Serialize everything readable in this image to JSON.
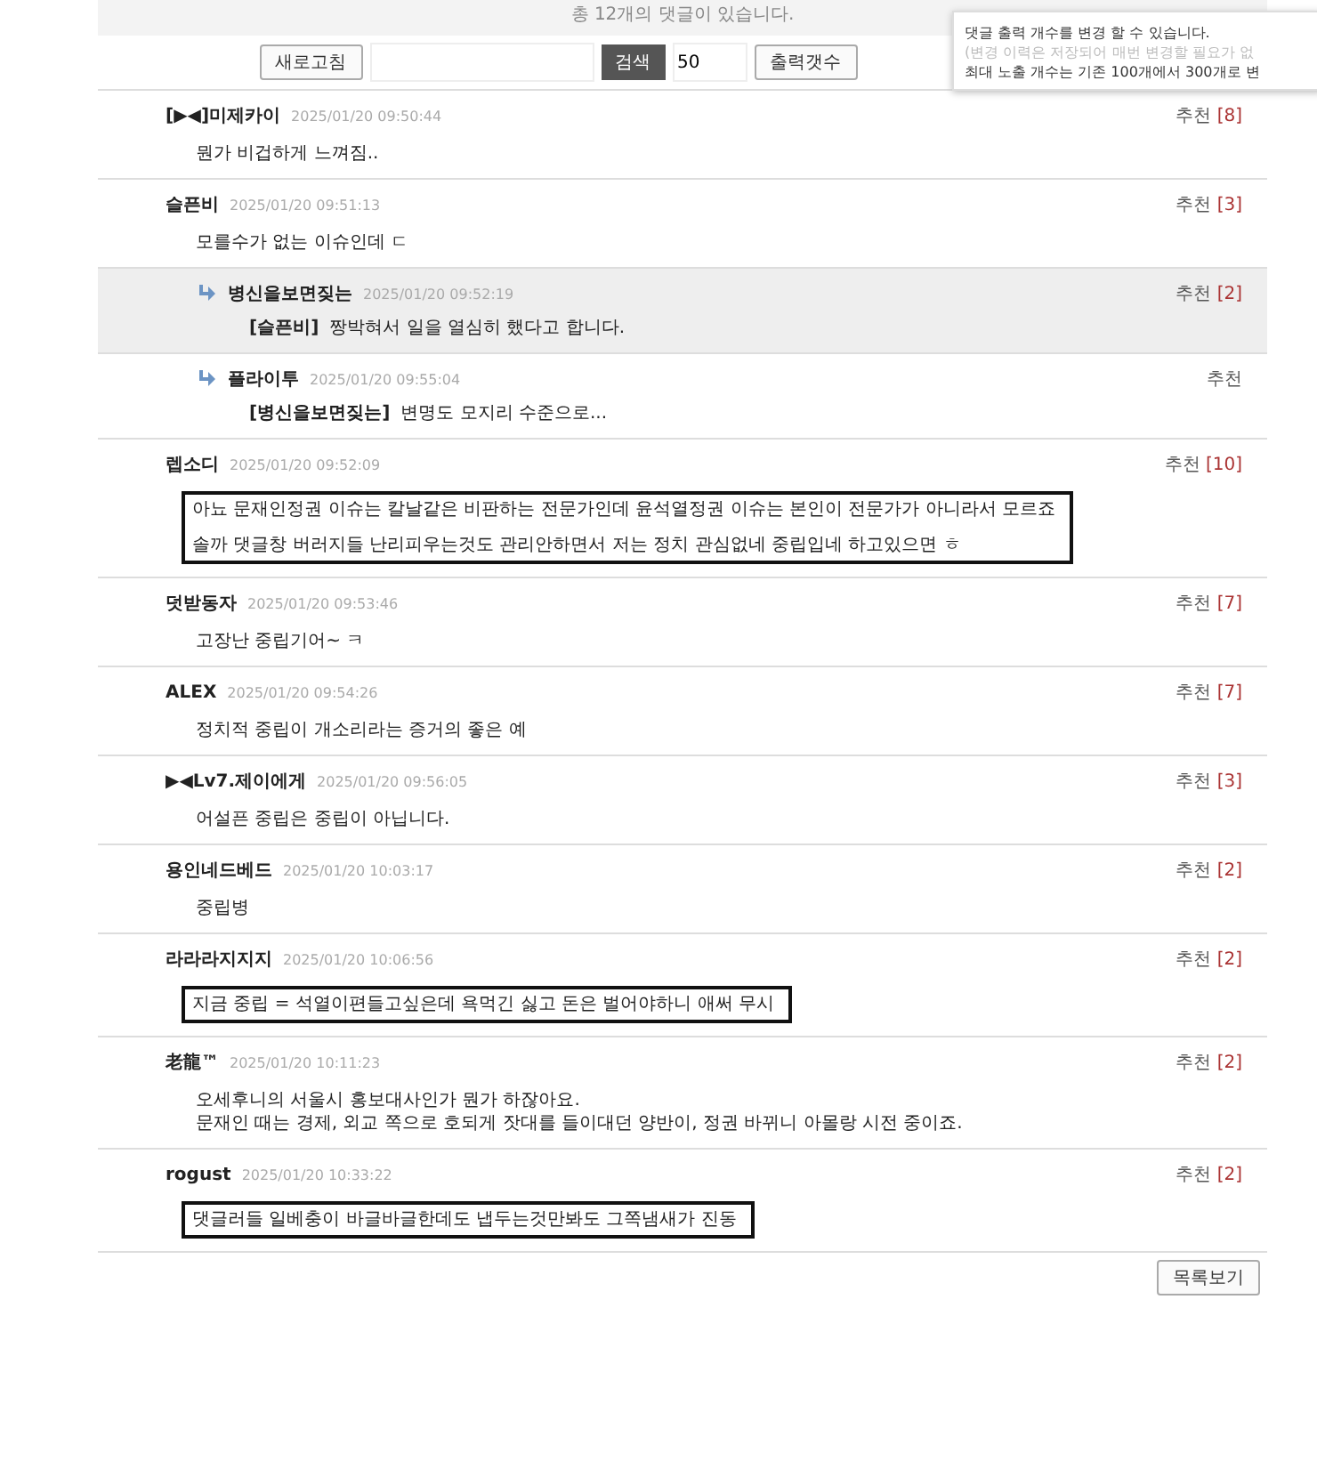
{
  "summary": "총 12개의 댓글이 있습니다.",
  "toolbar": {
    "refresh_button": "새로고침",
    "search_button": "검색",
    "count_value": "50",
    "count_button": "출력갯수"
  },
  "tooltip": {
    "lines": [
      "댓글 출력 개수를 변경 할 수 있습니다.",
      "(변경 이력은 저장되어 매번 변경할 필요가 없",
      "최대 노출 개수는 기존 100개에서 300개로 변"
    ]
  },
  "comments": [
    {
      "kind": "comment",
      "author": "[▶◀]미제카이",
      "time": "2025/01/20 09:50:44",
      "recommend": "추천",
      "count": "[8]",
      "highlighted": false,
      "boxed": false,
      "lines": [
        "뭔가 비겁하게 느껴짐.."
      ]
    },
    {
      "kind": "comment",
      "author": "슬픈비",
      "time": "2025/01/20 09:51:13",
      "recommend": "추천",
      "count": "[3]",
      "highlighted": false,
      "boxed": false,
      "lines": [
        "모를수가 없는 이슈인데 ㄷ"
      ]
    },
    {
      "kind": "reply",
      "author": "병신을보면짖는",
      "time": "2025/01/20 09:52:19",
      "recommend": "추천",
      "count": "[2]",
      "highlighted": true,
      "boxed": false,
      "target": "[슬픈비]",
      "lines": [
        "짱박혀서 일을 열심히 했다고 합니다."
      ]
    },
    {
      "kind": "reply",
      "author": "플라이투",
      "time": "2025/01/20 09:55:04",
      "recommend": "추천",
      "highlighted": false,
      "boxed": false,
      "target": "[병신을보면짖는]",
      "lines": [
        "변명도 모지리 수준으로..."
      ]
    },
    {
      "kind": "comment",
      "author": "렙소디",
      "time": "2025/01/20 09:52:09",
      "recommend": "추천",
      "count": "[10]",
      "highlighted": false,
      "boxed": true,
      "lines": [
        "아뇨 문재인정권 이슈는 칼날같은 비판하는 전문가인데 윤석열정권 이슈는 본인이 전문가가 아니라서 모르죠",
        "솔까 댓글창 버러지들 난리피우는것도 관리안하면서 저는 정치 관심없네 중립입네 하고있으면 ㅎ"
      ]
    },
    {
      "kind": "comment",
      "author": "덧받동자",
      "time": "2025/01/20 09:53:46",
      "recommend": "추천",
      "count": "[7]",
      "highlighted": false,
      "boxed": false,
      "lines": [
        "고장난 중립기어~ ㅋ"
      ]
    },
    {
      "kind": "comment",
      "author": "ALEX",
      "time": "2025/01/20 09:54:26",
      "recommend": "추천",
      "count": "[7]",
      "highlighted": false,
      "boxed": false,
      "lines": [
        "정치적 중립이 개소리라는 증거의 좋은 예"
      ]
    },
    {
      "kind": "comment",
      "author": "▶◀Lv7.제이에게",
      "time": "2025/01/20 09:56:05",
      "recommend": "추천",
      "count": "[3]",
      "highlighted": false,
      "boxed": false,
      "lines": [
        "어설픈 중립은 중립이 아닙니다."
      ]
    },
    {
      "kind": "comment",
      "author": "용인네드베드",
      "time": "2025/01/20 10:03:17",
      "recommend": "추천",
      "count": "[2]",
      "highlighted": false,
      "boxed": false,
      "lines": [
        "중립병"
      ]
    },
    {
      "kind": "comment",
      "author": "라라라지지지",
      "time": "2025/01/20 10:06:56",
      "recommend": "추천",
      "count": "[2]",
      "highlighted": false,
      "boxed": true,
      "lines": [
        "지금 중립 = 석열이편들고싶은데 욕먹긴 싫고 돈은 벌어야하니 애써 무시"
      ]
    },
    {
      "kind": "comment",
      "author": "老龍™",
      "time": "2025/01/20 10:11:23",
      "recommend": "추천",
      "count": "[2]",
      "highlighted": false,
      "boxed": false,
      "lines": [
        "오세후니의 서울시 홍보대사인가 뭔가 하잖아요.",
        "문재인 때는 경제, 외교 쪽으로 호되게 잣대를 들이대던 양반이, 정권 바뀌니 아몰랑 시전 중이죠."
      ]
    },
    {
      "kind": "comment",
      "author": "rogust",
      "time": "2025/01/20 10:33:22",
      "recommend": "추천",
      "count": "[2]",
      "highlighted": false,
      "boxed": true,
      "lines": [
        "댓글러들 일베충이 바글바글한데도 냅두는것만봐도 그쪽냄새가 진동"
      ]
    }
  ],
  "list_button": "목록보기"
}
